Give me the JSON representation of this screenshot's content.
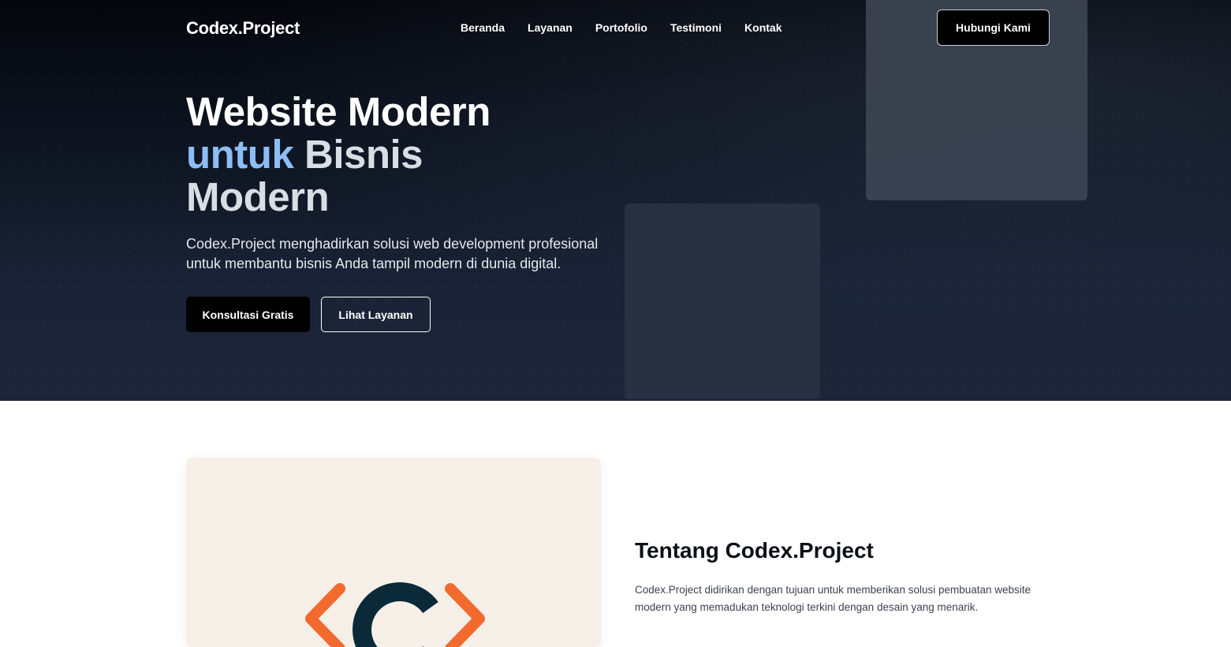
{
  "nav": {
    "logo": "Codex.Project",
    "links": [
      "Beranda",
      "Layanan",
      "Portofolio",
      "Testimoni",
      "Kontak"
    ],
    "cta": "Hubungi Kami"
  },
  "hero": {
    "line1": "Website Modern",
    "accent": "untuk",
    "line2_rest": " Bisnis",
    "line3": "Modern",
    "subtitle": "Codex.Project menghadirkan solusi web development profesional untuk membantu bisnis Anda tampil modern di dunia digital.",
    "primary_button": "Konsultasi Gratis",
    "secondary_button": "Lihat Layanan"
  },
  "about": {
    "title": "Tentang Codex.Project",
    "text": "Codex.Project didirikan dengan tujuan untuk memberikan solusi pembuatan website modern yang memadukan teknologi terkini dengan desain yang menarik."
  },
  "colors": {
    "accent": "#8dbdf5",
    "brand_dark": "#0a2a3a",
    "brand_orange": "#f26a2e",
    "card_bg": "#f5efe8"
  }
}
